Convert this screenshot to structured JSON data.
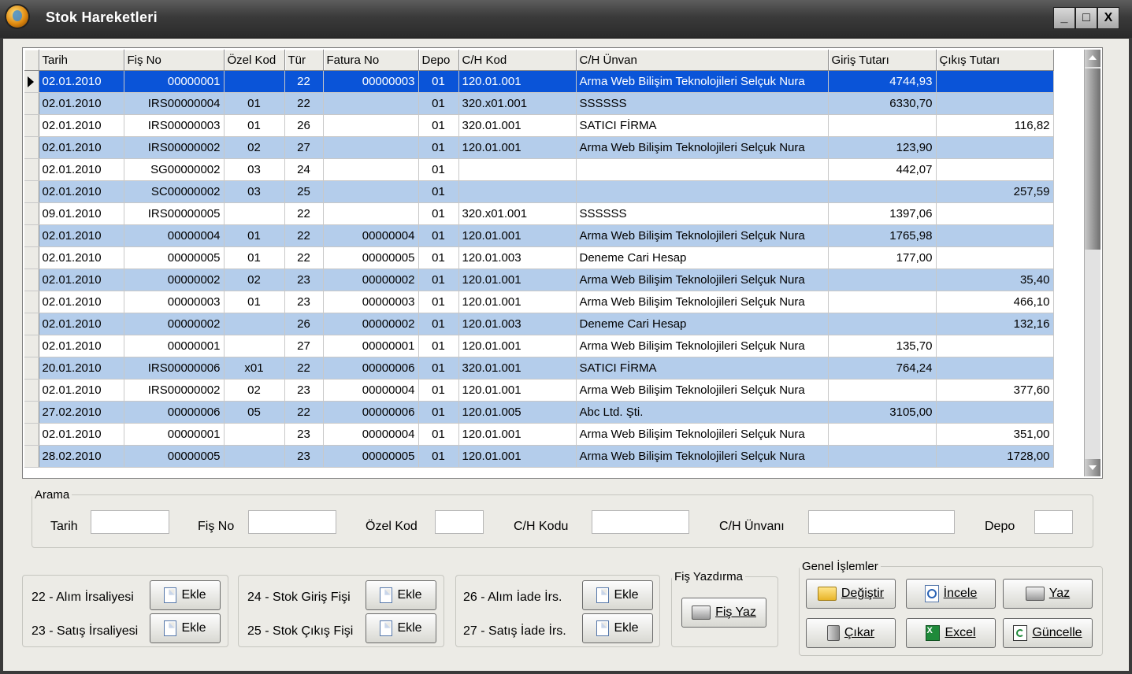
{
  "window": {
    "title": "Stok Hareketleri",
    "buttons": [
      "_",
      "□",
      "X"
    ]
  },
  "grid": {
    "columns": [
      "Tarih",
      "Fiş No",
      "Özel Kod",
      "Tür",
      "Fatura No",
      "Depo",
      "C/H Kod",
      "C/H Ünvan",
      "Giriş Tutarı",
      "Çıkış Tutarı"
    ],
    "rows": [
      {
        "tarih": "02.01.2010",
        "fis": "00000001",
        "ozel": "",
        "tur": "22",
        "fatura": "00000003",
        "depo": "01",
        "chkod": "120.01.001",
        "unvan": "Arma Web Bilişim Teknolojileri Selçuk Nura",
        "giris": "4744,93",
        "cikis": ""
      },
      {
        "tarih": "02.01.2010",
        "fis": "IRS00000004",
        "ozel": "01",
        "tur": "22",
        "fatura": "",
        "depo": "01",
        "chkod": "320.x01.001",
        "unvan": "SSSSSS",
        "giris": "6330,70",
        "cikis": ""
      },
      {
        "tarih": "02.01.2010",
        "fis": "IRS00000003",
        "ozel": "01",
        "tur": "26",
        "fatura": "",
        "depo": "01",
        "chkod": "320.01.001",
        "unvan": "SATICI FİRMA",
        "giris": "",
        "cikis": "116,82"
      },
      {
        "tarih": "02.01.2010",
        "fis": "IRS00000002",
        "ozel": "02",
        "tur": "27",
        "fatura": "",
        "depo": "01",
        "chkod": "120.01.001",
        "unvan": "Arma Web Bilişim Teknolojileri Selçuk Nura",
        "giris": "123,90",
        "cikis": ""
      },
      {
        "tarih": "02.01.2010",
        "fis": "SG00000002",
        "ozel": "03",
        "tur": "24",
        "fatura": "",
        "depo": "01",
        "chkod": "",
        "unvan": "",
        "giris": "442,07",
        "cikis": ""
      },
      {
        "tarih": "02.01.2010",
        "fis": "SC00000002",
        "ozel": "03",
        "tur": "25",
        "fatura": "",
        "depo": "01",
        "chkod": "",
        "unvan": "",
        "giris": "",
        "cikis": "257,59"
      },
      {
        "tarih": "09.01.2010",
        "fis": "IRS00000005",
        "ozel": "",
        "tur": "22",
        "fatura": "",
        "depo": "01",
        "chkod": "320.x01.001",
        "unvan": "SSSSSS",
        "giris": "1397,06",
        "cikis": ""
      },
      {
        "tarih": "02.01.2010",
        "fis": "00000004",
        "ozel": "01",
        "tur": "22",
        "fatura": "00000004",
        "depo": "01",
        "chkod": "120.01.001",
        "unvan": "Arma Web Bilişim Teknolojileri Selçuk Nura",
        "giris": "1765,98",
        "cikis": ""
      },
      {
        "tarih": "02.01.2010",
        "fis": "00000005",
        "ozel": "01",
        "tur": "22",
        "fatura": "00000005",
        "depo": "01",
        "chkod": "120.01.003",
        "unvan": "Deneme Cari Hesap",
        "giris": "177,00",
        "cikis": ""
      },
      {
        "tarih": "02.01.2010",
        "fis": "00000002",
        "ozel": "02",
        "tur": "23",
        "fatura": "00000002",
        "depo": "01",
        "chkod": "120.01.001",
        "unvan": "Arma Web Bilişim Teknolojileri Selçuk Nura",
        "giris": "",
        "cikis": "35,40"
      },
      {
        "tarih": "02.01.2010",
        "fis": "00000003",
        "ozel": "01",
        "tur": "23",
        "fatura": "00000003",
        "depo": "01",
        "chkod": "120.01.001",
        "unvan": "Arma Web Bilişim Teknolojileri Selçuk Nura",
        "giris": "",
        "cikis": "466,10"
      },
      {
        "tarih": "02.01.2010",
        "fis": "00000002",
        "ozel": "",
        "tur": "26",
        "fatura": "00000002",
        "depo": "01",
        "chkod": "120.01.003",
        "unvan": "Deneme Cari Hesap",
        "giris": "",
        "cikis": "132,16"
      },
      {
        "tarih": "02.01.2010",
        "fis": "00000001",
        "ozel": "",
        "tur": "27",
        "fatura": "00000001",
        "depo": "01",
        "chkod": "120.01.001",
        "unvan": "Arma Web Bilişim Teknolojileri Selçuk Nura",
        "giris": "135,70",
        "cikis": ""
      },
      {
        "tarih": "20.01.2010",
        "fis": "IRS00000006",
        "ozel": "x01",
        "tur": "22",
        "fatura": "00000006",
        "depo": "01",
        "chkod": "320.01.001",
        "unvan": "SATICI FİRMA",
        "giris": "764,24",
        "cikis": ""
      },
      {
        "tarih": "02.01.2010",
        "fis": "IRS00000002",
        "ozel": "02",
        "tur": "23",
        "fatura": "00000004",
        "depo": "01",
        "chkod": "120.01.001",
        "unvan": "Arma Web Bilişim Teknolojileri Selçuk Nura",
        "giris": "",
        "cikis": "377,60"
      },
      {
        "tarih": "27.02.2010",
        "fis": "00000006",
        "ozel": "05",
        "tur": "22",
        "fatura": "00000006",
        "depo": "01",
        "chkod": "120.01.005",
        "unvan": "Abc Ltd. Şti.",
        "giris": "3105,00",
        "cikis": ""
      },
      {
        "tarih": "02.01.2010",
        "fis": "00000001",
        "ozel": "",
        "tur": "23",
        "fatura": "00000004",
        "depo": "01",
        "chkod": "120.01.001",
        "unvan": "Arma Web Bilişim Teknolojileri Selçuk Nura",
        "giris": "",
        "cikis": "351,00"
      },
      {
        "tarih": "28.02.2010",
        "fis": "00000005",
        "ozel": "",
        "tur": "23",
        "fatura": "00000005",
        "depo": "01",
        "chkod": "120.01.001",
        "unvan": "Arma Web Bilişim Teknolojileri Selçuk Nura",
        "giris": "",
        "cikis": "1728,00"
      }
    ]
  },
  "search": {
    "legend": "Arama",
    "tarih_label": "Tarih",
    "fis_label": "Fiş No",
    "ozel_label": "Özel Kod",
    "chkodu_label": "C/H Kodu",
    "chunvan_label": "C/H Ünvanı",
    "depo_label": "Depo",
    "tarih_value": "",
    "fis_value": "",
    "ozel_value": "",
    "chkodu_value": "",
    "chunvan_value": "",
    "depo_value": ""
  },
  "irsaliye": {
    "alim_label": "22 - Alım İrsaliyesi",
    "satis_label": "23 - Satış İrsaliyesi",
    "add_label": "Ekle"
  },
  "stokfis": {
    "giris_label": "24 - Stok Giriş Fişi",
    "cikis_label": "25 - Stok Çıkış Fişi",
    "add_label": "Ekle"
  },
  "iade": {
    "alim_label": "26 - Alım İade İrs.",
    "satis_label": "27 - Satış İade İrs.",
    "add_label": "Ekle"
  },
  "fis_yazdirma": {
    "legend": "Fiş Yazdırma",
    "button": "Fiş Yaz"
  },
  "genel": {
    "legend": "Genel İşlemler",
    "degistir": "Değiştir",
    "incele": "İncele",
    "yaz": "Yaz",
    "cikar": "Çıkar",
    "excel": "Excel",
    "guncelle": "Güncelle"
  }
}
